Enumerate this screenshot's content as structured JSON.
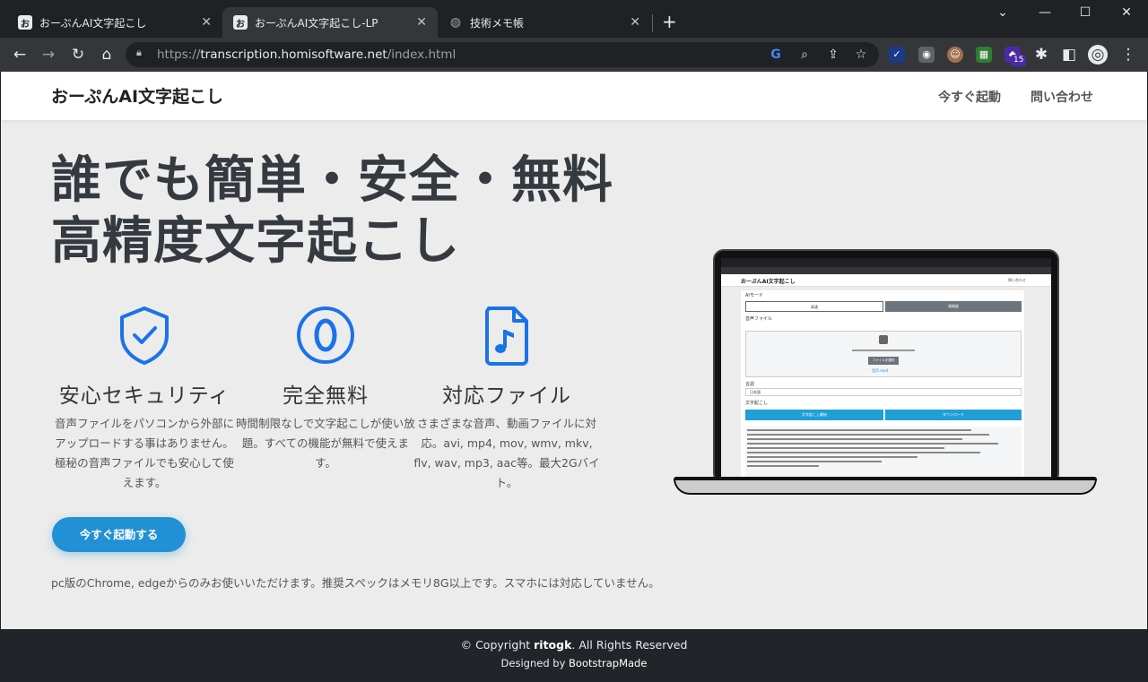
{
  "browser": {
    "tabs": [
      {
        "label": "おーぷんAI文字起こし",
        "favicon": "お",
        "active": false
      },
      {
        "label": "おーぷんAI文字起こし-LP",
        "favicon": "お",
        "active": true
      },
      {
        "label": "技術メモ帳",
        "favicon": "globe",
        "active": false
      }
    ],
    "url_scheme": "https://",
    "url_host": "transcription.homisoftware.net",
    "url_path": "/index.html",
    "extension_badge": "15"
  },
  "navbar": {
    "brand": "おーぷんAI文字起こし",
    "links": [
      "今すぐ起動",
      "問い合わせ"
    ]
  },
  "hero": {
    "title_line1": "誰でも簡単・安全・無料",
    "title_line2": "高精度文字起こし"
  },
  "features": [
    {
      "icon": "shield-check-icon",
      "title": "安心セキュリティ",
      "desc": "音声ファイルをパソコンから外部にアップロードする事はありません。極秘の音声ファイルでも安心して使えます。"
    },
    {
      "icon": "zero-circle-icon",
      "title": "完全無料",
      "desc": "時間制限なしで文字起こしが使い放題。すべての機能が無料で使えます。"
    },
    {
      "icon": "music-file-icon",
      "title": "対応ファイル",
      "desc": "さまざまな音声、動画ファイルに対応。avi, mp4, mov, wmv, mkv, flv, wav, mp3, aac等。最大2Gバイト。"
    }
  ],
  "cta_label": "今すぐ起動する",
  "note": "pc版のChrome, edgeからのみお使いいただけます。推奨スペックはメモリ8G以上です。スマホには対応していません。",
  "footer": {
    "copy_prefix": "© Copyright ",
    "copy_owner": "ritogk",
    "copy_suffix": ". All Rights Reserved",
    "designed_prefix": "Designed by ",
    "designed_by": "BootstrapMade"
  },
  "mockup": {
    "brand": "おーぷんAI文字起こし",
    "link": "問い合わせ",
    "ai_mode_label": "AIモード",
    "mode_btn1": "高速",
    "mode_btn2": "高精度",
    "audio_label": "音声ファイル",
    "upload_btn": "ファイルを選択",
    "file_name": "音声.mp4",
    "language_label": "言語",
    "language_value": "日本語",
    "transcript_label": "文字起こし",
    "copy_btn": "文字起こし開始",
    "download_btn": "ダウンロード"
  },
  "colors": {
    "accent": "#2290d4",
    "icon_blue": "#1a73e8",
    "footer_bg": "#212529",
    "page_bg": "#ececec"
  }
}
